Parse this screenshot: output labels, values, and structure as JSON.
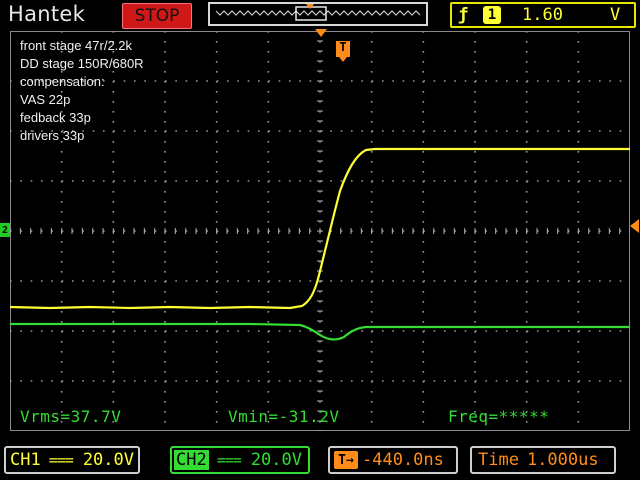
{
  "header": {
    "brand": "Hantek",
    "run_state": "STOP",
    "trigger": {
      "edge_icon": "rising-edge-icon",
      "source": "1",
      "level": "1.60",
      "unit": "V"
    }
  },
  "annotation_lines": [
    "front stage 47r/2.2k",
    "DD stage 150R/680R",
    "compensation:",
    "VAS 22p",
    "fedback 33p",
    "drivers 33p"
  ],
  "markers": {
    "trigger_time": "T",
    "ch2_ground": "2"
  },
  "measurements": {
    "vrms": "Vrms=37.7V",
    "vmin": "Vmin=-31.2V",
    "freq": "Freq=*****"
  },
  "footer": {
    "ch1": {
      "label": "CH1",
      "coupling": "===",
      "scale": "20.0V"
    },
    "ch2": {
      "label": "CH2",
      "coupling": "===",
      "scale": "20.0V"
    },
    "horizontal_position": "-440.0ns",
    "timebase": {
      "label": "Time",
      "value": "1.000us"
    }
  },
  "colors": {
    "ch1": "#ffff33",
    "ch2": "#33dd33",
    "accent": "#ff8c1a",
    "stop": "#d01818"
  }
}
